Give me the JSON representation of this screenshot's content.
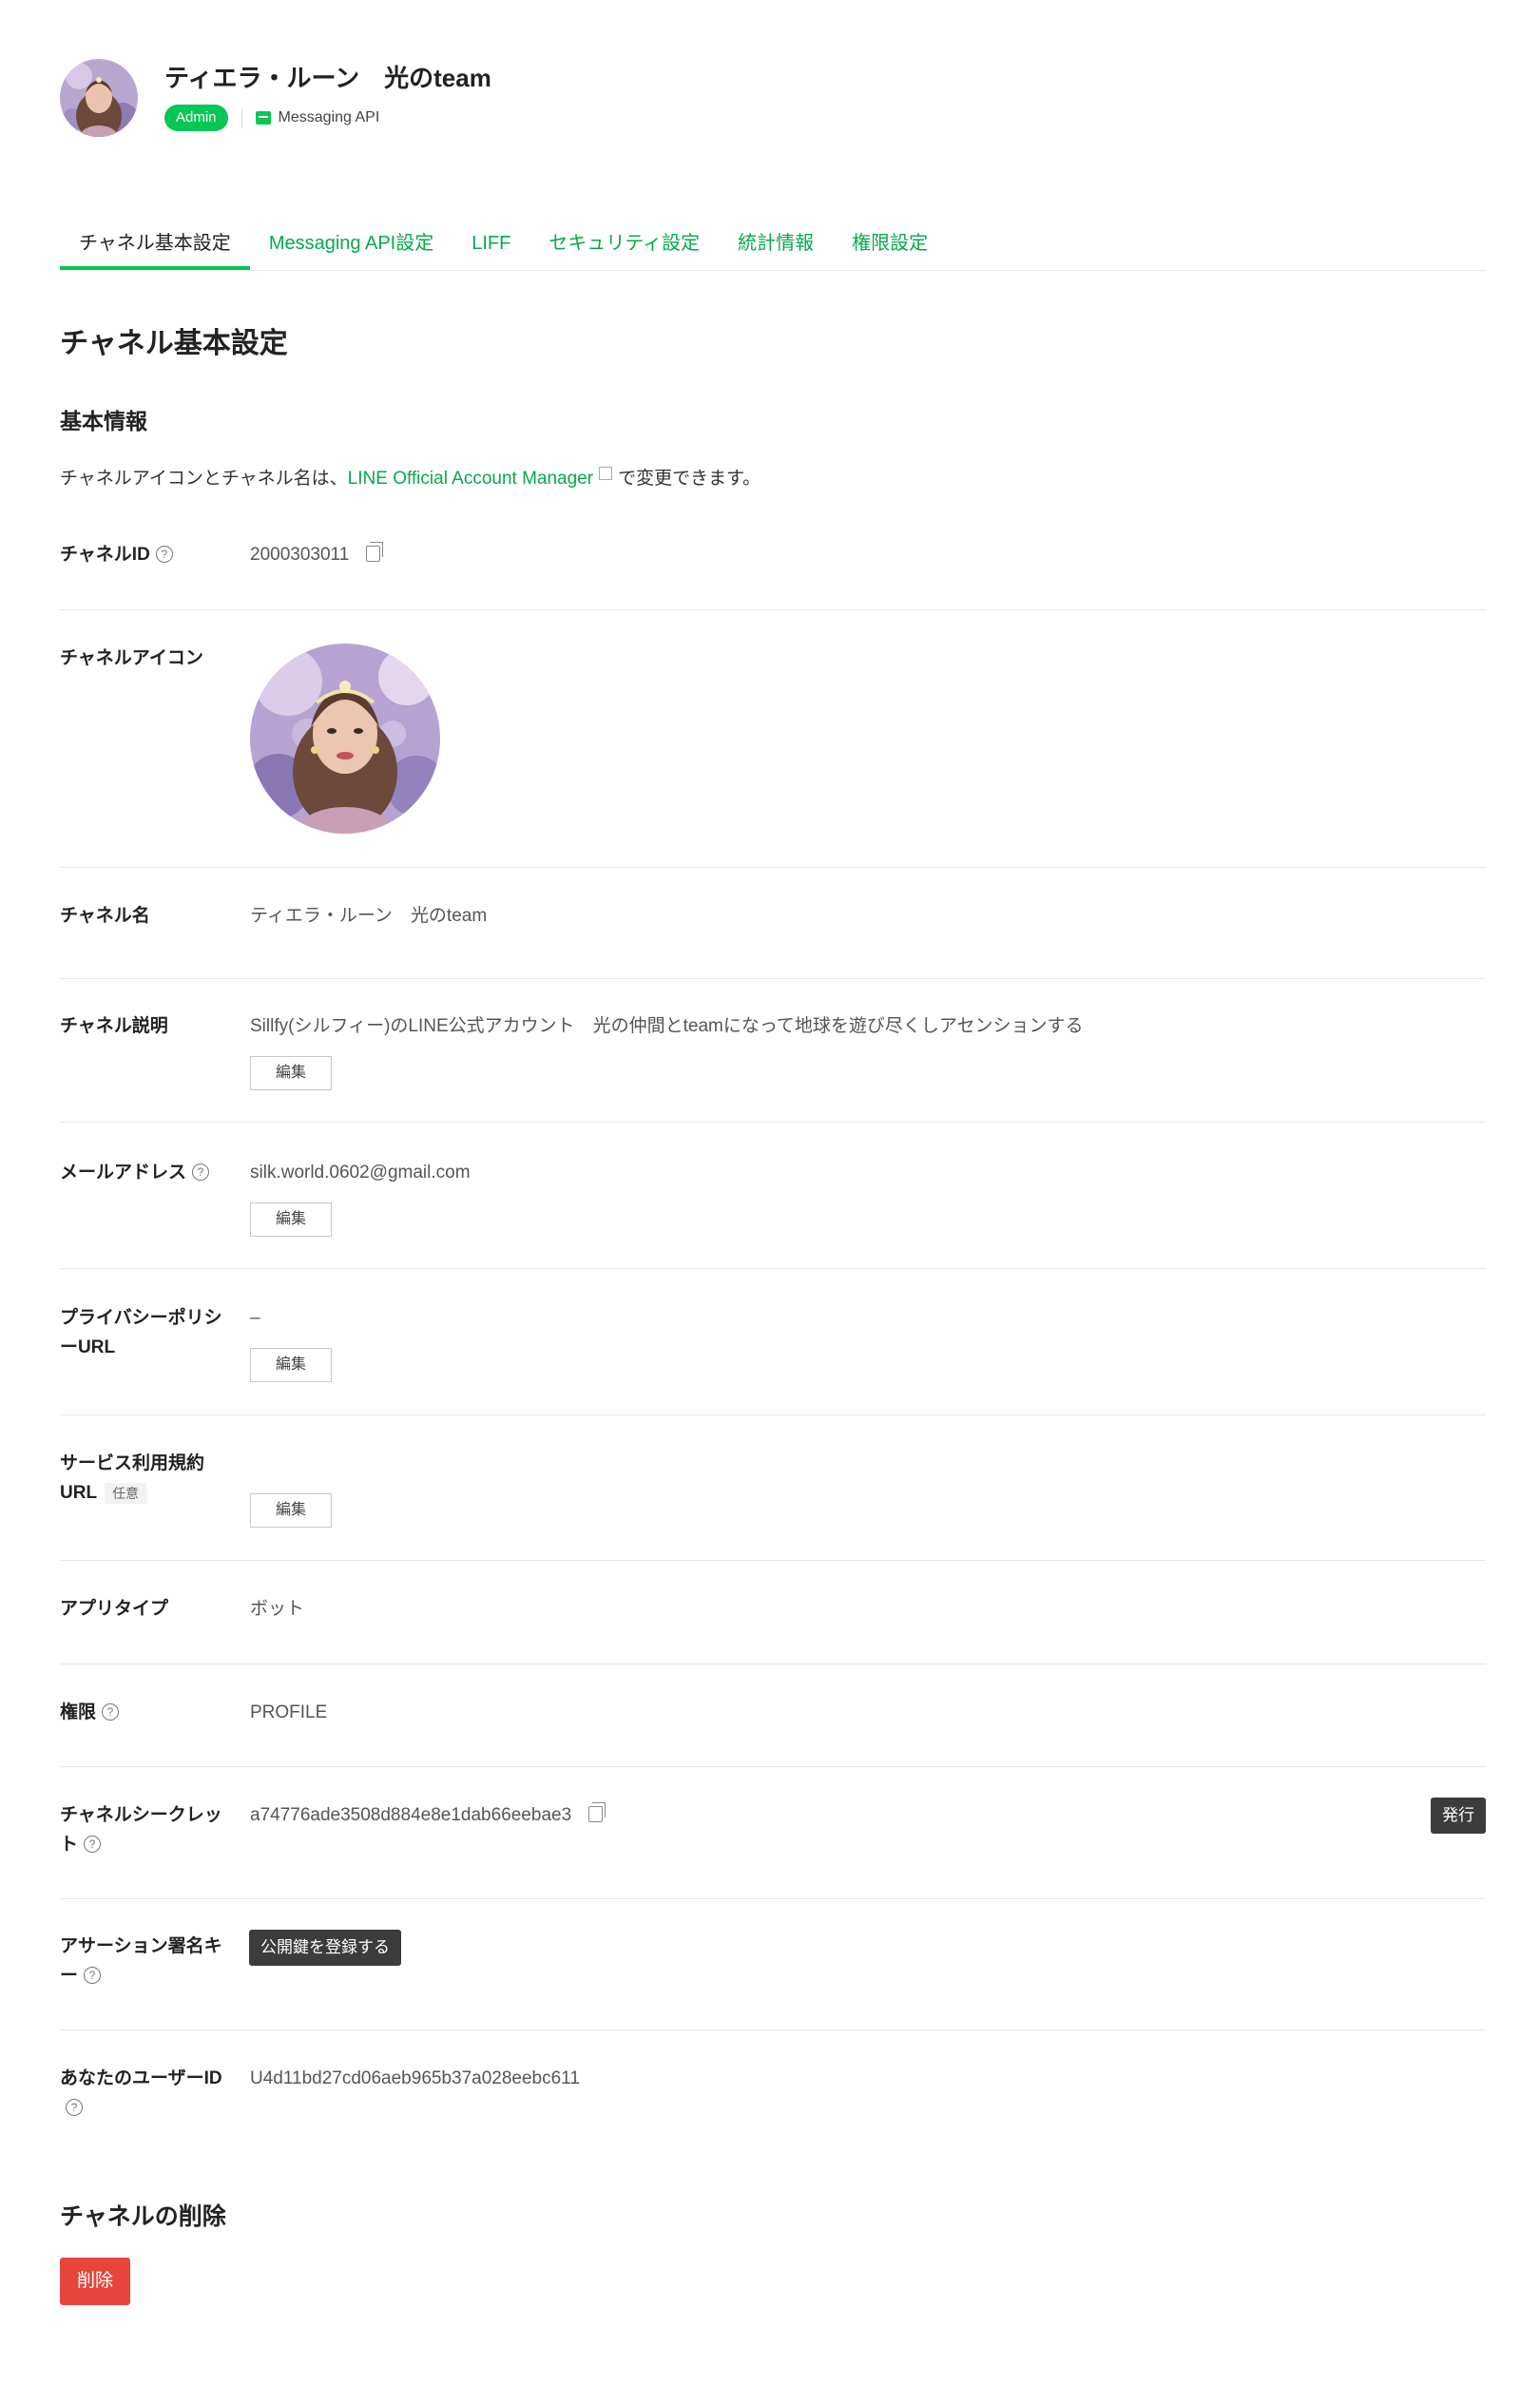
{
  "header": {
    "title": "ティエラ・ルーン　光のteam",
    "badge": "Admin",
    "channel_type": "Messaging API"
  },
  "tabs": [
    {
      "label": "チャネル基本設定",
      "active": true
    },
    {
      "label": "Messaging API設定"
    },
    {
      "label": "LIFF"
    },
    {
      "label": "セキュリティ設定"
    },
    {
      "label": "統計情報"
    },
    {
      "label": "権限設定"
    }
  ],
  "page_title": "チャネル基本設定",
  "section_basic": "基本情報",
  "description": {
    "before": "チャネルアイコンとチャネル名は、",
    "link": "LINE Official Account Manager",
    "after": "で変更できます。"
  },
  "fields": {
    "channel_id": {
      "label": "チャネルID",
      "value": "2000303011"
    },
    "channel_icon": {
      "label": "チャネルアイコン"
    },
    "channel_name": {
      "label": "チャネル名",
      "value": "ティエラ・ルーン　光のteam"
    },
    "channel_desc": {
      "label": "チャネル説明",
      "value": "Sillfy(シルフィー)のLINE公式アカウント　光の仲間とteamになって地球を遊び尽くしアセンションする"
    },
    "email": {
      "label": "メールアドレス",
      "value": "silk.world.0602@gmail.com"
    },
    "privacy_url": {
      "label": "プライバシーポリシーURL",
      "value": "–"
    },
    "terms_url": {
      "label": "サービス利用規約URL",
      "optional": "任意"
    },
    "app_type": {
      "label": "アプリタイプ",
      "value": "ボット"
    },
    "permission": {
      "label": "権限",
      "value": "PROFILE"
    },
    "channel_secret": {
      "label": "チャネルシークレット",
      "value": "a74776ade3508d884e8e1dab66eebae3"
    },
    "assertion_key": {
      "label": "アサーション署名キー"
    },
    "user_id": {
      "label": "あなたのユーザーID",
      "value": "U4d11bd27cd06aeb965b37a028eebc611"
    }
  },
  "buttons": {
    "edit": "編集",
    "issue": "発行",
    "register_key": "公開鍵を登録する",
    "delete": "削除"
  },
  "section_delete": "チャネルの削除",
  "colors": {
    "accent": "#06c755",
    "link": "#06a94b",
    "danger": "#e5453a",
    "dark_button": "#3c3c3c"
  }
}
